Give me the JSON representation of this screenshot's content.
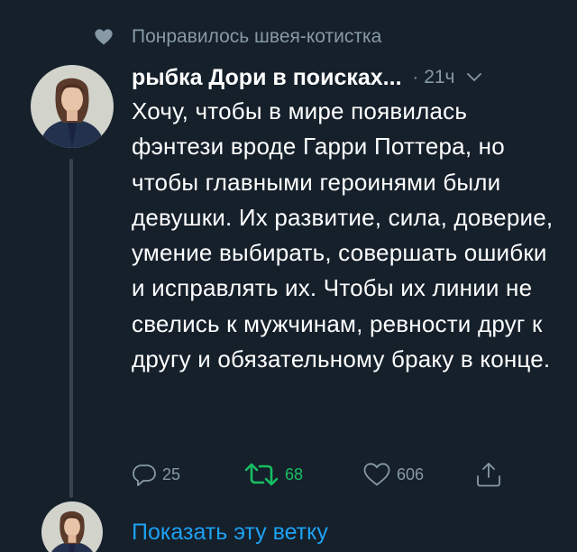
{
  "context": {
    "liked_text": "Понравилось швея-котистка",
    "icon": "heart-icon"
  },
  "tweet": {
    "author_name": "рыбка Дори в поисках...",
    "separator": "·",
    "timestamp": "21ч",
    "menu_icon": "chevron-down-icon",
    "text": "Хочу, чтобы в мире появилась фэнтези вроде Гарри Поттера, но чтобы главными героинями были девушки. Их развитие, сила, доверие, умение выбирать, совершать ошибки и исправлять их. Чтобы их линии не свелись к мужчинам, ревности друг к другу и обязательному браку в конце.",
    "actions": {
      "reply": {
        "icon": "reply-icon",
        "count": "25"
      },
      "retweet": {
        "icon": "retweet-icon",
        "count": "68",
        "active": true,
        "color": "#17bf63"
      },
      "like": {
        "icon": "heart-outline-icon",
        "count": "606"
      },
      "share": {
        "icon": "share-icon"
      }
    }
  },
  "thread": {
    "show_thread_label": "Показать эту ветку"
  },
  "colors": {
    "background": "#15202b",
    "secondary_text": "#8899a6",
    "link": "#1da1f2",
    "retweet_active": "#17bf63"
  }
}
